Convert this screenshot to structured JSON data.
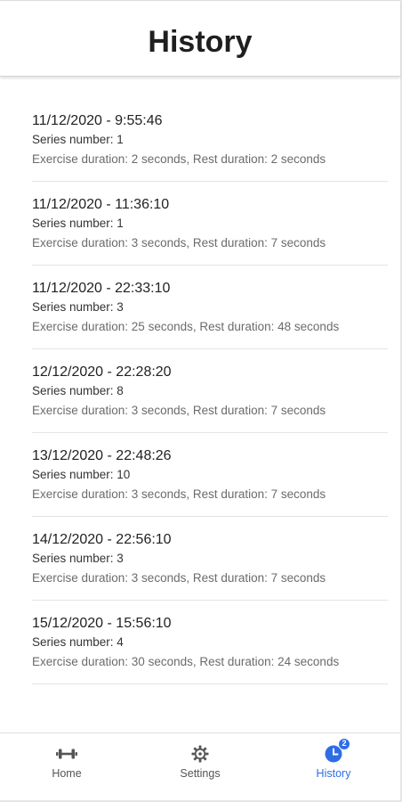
{
  "header": {
    "title": "History"
  },
  "entries": [
    {
      "date": "11/12/2020 - 9:55:46",
      "series": "Series number: 1",
      "durations": "Exercise duration: 2 seconds, Rest duration: 2 seconds"
    },
    {
      "date": "11/12/2020 - 11:36:10",
      "series": "Series number: 1",
      "durations": "Exercise duration: 3 seconds, Rest duration: 7 seconds"
    },
    {
      "date": "11/12/2020 - 22:33:10",
      "series": "Series number: 3",
      "durations": "Exercise duration: 25 seconds, Rest duration: 48 seconds"
    },
    {
      "date": "12/12/2020 - 22:28:20",
      "series": "Series number: 8",
      "durations": "Exercise duration: 3 seconds, Rest duration: 7 seconds"
    },
    {
      "date": "13/12/2020 - 22:48:26",
      "series": "Series number: 10",
      "durations": "Exercise duration: 3 seconds, Rest duration: 7 seconds"
    },
    {
      "date": "14/12/2020 - 22:56:10",
      "series": "Series number: 3",
      "durations": "Exercise duration: 3 seconds, Rest duration: 7 seconds"
    },
    {
      "date": "15/12/2020 - 15:56:10",
      "series": "Series number: 4",
      "durations": "Exercise duration: 30 seconds, Rest duration: 24 seconds"
    }
  ],
  "tabbar": {
    "tabs": [
      {
        "label": "Home",
        "icon": "dumbbell-icon",
        "active": false
      },
      {
        "label": "Settings",
        "icon": "gear-icon",
        "active": false
      },
      {
        "label": "History",
        "icon": "clock-icon",
        "active": true,
        "badge": "2"
      }
    ]
  },
  "colors": {
    "accent": "#2f6de6",
    "text_primary": "#222222",
    "text_secondary": "#6b6b6b",
    "divider": "#e4e4e4"
  }
}
